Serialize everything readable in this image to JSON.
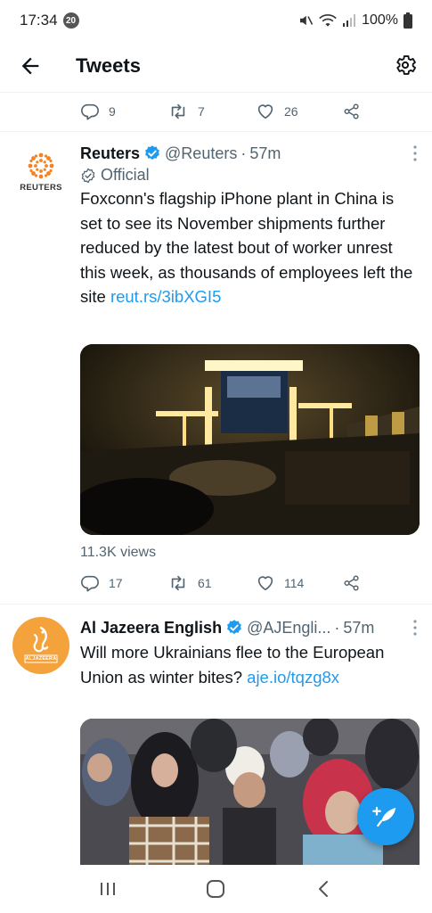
{
  "status_bar": {
    "time": "17:34",
    "notification_count": "20",
    "battery": "100%"
  },
  "header": {
    "title": "Tweets"
  },
  "top_tweet_actions": {
    "replies": "9",
    "retweets": "7",
    "likes": "26"
  },
  "tweets": [
    {
      "display_name": "Reuters",
      "handle": "@Reuters",
      "separator": "·",
      "time": "57m",
      "label": "Official",
      "avatar_text": "REUTERS",
      "text": "Foxconn's flagship iPhone plant in China is set to see its November shipments further reduced by the latest bout of worker unrest this week, as thousands of employees left the site ",
      "link": "reut.rs/3ibXGI5",
      "views": "11.3K views",
      "replies": "17",
      "retweets": "61",
      "likes": "114"
    },
    {
      "display_name": "Al Jazeera English",
      "handle": "@AJEngli...",
      "separator": "·",
      "time": "57m",
      "avatar_text": "ALJAZEERA",
      "text": "Will more Ukrainians flee to the European Union as winter bites? ",
      "link": "aje.io/tqzg8x"
    }
  ],
  "colors": {
    "accent": "#1d9bf0",
    "secondary_text": "#536471",
    "aljazeera_orange": "#f4a23b"
  }
}
